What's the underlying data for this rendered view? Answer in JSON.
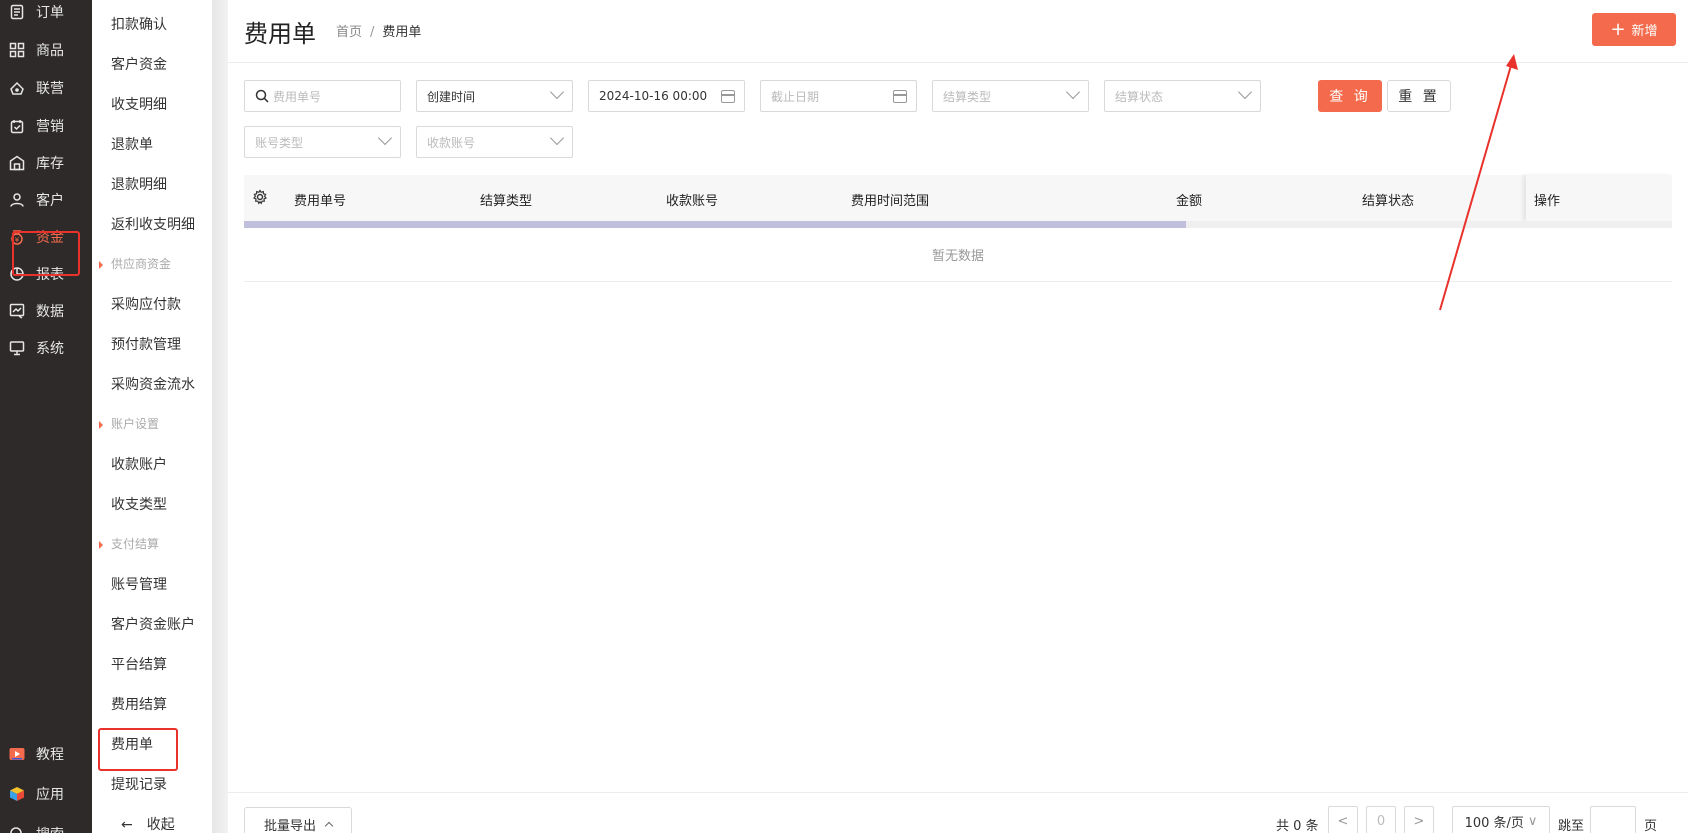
{
  "nav": {
    "items": [
      {
        "label": "订单",
        "icon": "order-icon"
      },
      {
        "label": "商品",
        "icon": "goods-icon"
      },
      {
        "label": "联营",
        "icon": "joint-icon"
      },
      {
        "label": "营销",
        "icon": "marketing-icon"
      },
      {
        "label": "库存",
        "icon": "warehouse-icon"
      },
      {
        "label": "客户",
        "icon": "user-icon"
      },
      {
        "label": "资金",
        "icon": "money-bag-icon"
      },
      {
        "label": "报表",
        "icon": "pie-chart-icon"
      },
      {
        "label": "数据",
        "icon": "data-icon"
      },
      {
        "label": "系统",
        "icon": "monitor-icon"
      }
    ],
    "active_item": "资金",
    "bottom_items": [
      {
        "label": "教程",
        "icon": "video-icon"
      },
      {
        "label": "应用",
        "icon": "cube-icon"
      },
      {
        "label": "搜索",
        "icon": "search-icon"
      }
    ]
  },
  "submenu": {
    "items": [
      {
        "label": "扣款确认"
      },
      {
        "label": "客户资金"
      },
      {
        "label": "收支明细"
      },
      {
        "label": "退款单"
      },
      {
        "label": "退款明细"
      },
      {
        "label": "返利收支明细"
      }
    ],
    "groups": [
      {
        "title": "供应商资金",
        "items": [
          "采购应付款",
          "预付款管理",
          "采购资金流水"
        ]
      },
      {
        "title": "账户设置",
        "items": [
          "收款账户",
          "收支类型"
        ]
      },
      {
        "title": "支付结算",
        "items": [
          "账号管理",
          "客户资金账户",
          "平台结算",
          "费用结算",
          "费用单",
          "提现记录"
        ]
      }
    ],
    "active_item": "费用单",
    "collapse_label": "收起"
  },
  "header": {
    "title": "费用单",
    "breadcrumb": [
      "首页",
      "费用单"
    ],
    "add_button": "新增"
  },
  "filters": {
    "order_no_placeholder": "费用单号",
    "time_type": "创建时间",
    "start_date": "2024-10-16 00:00",
    "end_date_placeholder": "截止日期",
    "settle_type_placeholder": "结算类型",
    "settle_status_placeholder": "结算状态",
    "account_type_placeholder": "账号类型",
    "receive_account_placeholder": "收款账号",
    "query_button": "查 询",
    "reset_button": "重 置"
  },
  "table": {
    "columns": [
      "费用单号",
      "结算类型",
      "收款账号",
      "费用时间范围",
      "金额",
      "结算状态",
      "操作"
    ],
    "empty_text": "暂无数据",
    "scroll_fraction": 0.66
  },
  "footer": {
    "export_button": "批量导出",
    "total": "共 0 条",
    "current_page": "0",
    "page_size": "100 条/页",
    "jump_label": "跳至",
    "page_suffix": "页"
  },
  "colors": {
    "accent": "#f36b4c",
    "nav_bg": "#2e2a29",
    "highlight": "#e8322b"
  }
}
